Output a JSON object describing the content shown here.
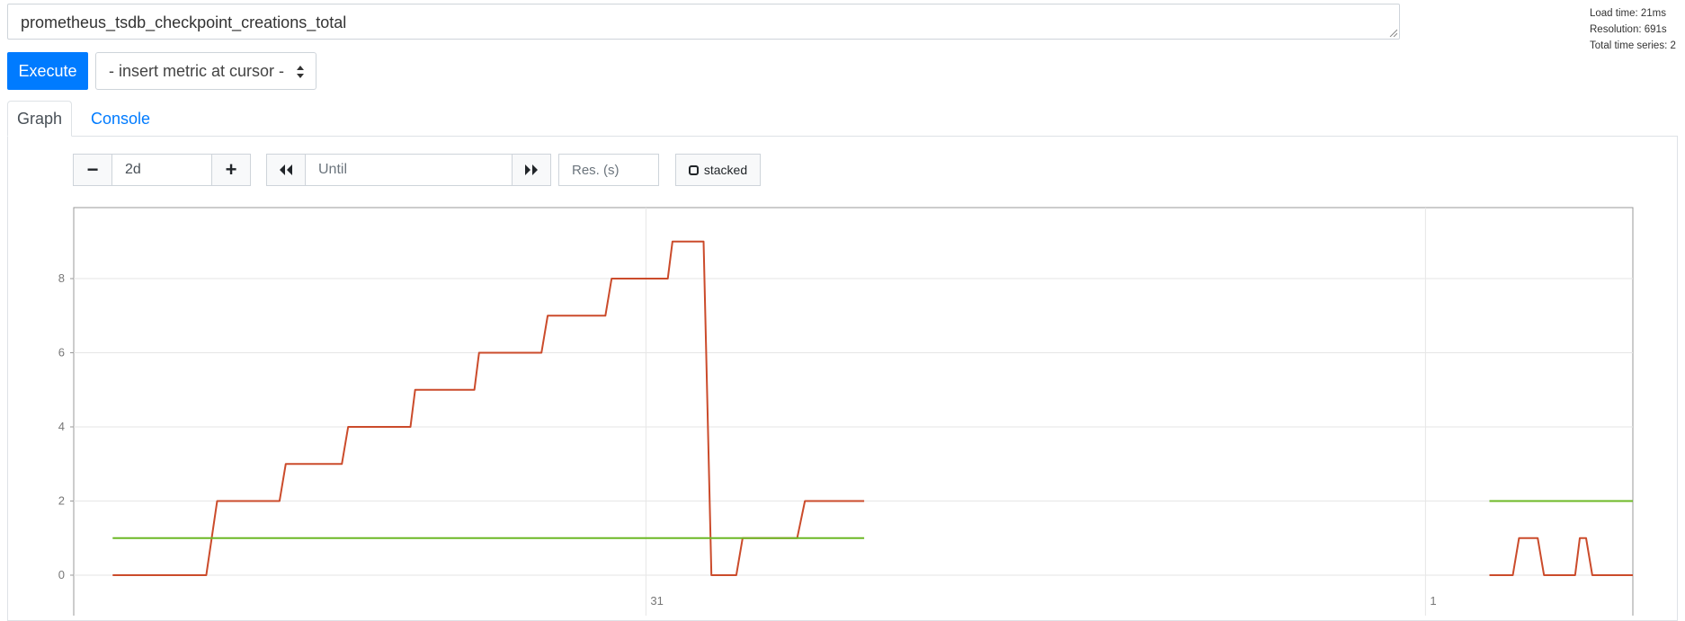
{
  "query": {
    "value": "prometheus_tsdb_checkpoint_creations_total"
  },
  "stats": {
    "load_time": "Load time: 21ms",
    "resolution": "Resolution: 691s",
    "total_series": "Total time series: 2"
  },
  "toolbar": {
    "execute_label": "Execute",
    "metric_select_label": "- insert metric at cursor -"
  },
  "tabs": [
    {
      "label": "Graph",
      "active": true
    },
    {
      "label": "Console",
      "active": false
    }
  ],
  "graph_controls": {
    "range_decrease": "−",
    "range_value": "2d",
    "range_increase": "+",
    "back_icon": "double-chevron-left-icon",
    "until_placeholder": "Until",
    "forward_icon": "double-chevron-right-icon",
    "resolution_placeholder": "Res. (s)",
    "stacked_label": "stacked"
  },
  "chart_data": {
    "type": "line",
    "ylim": [
      0,
      9.6
    ],
    "yticks": [
      0,
      2,
      4,
      6,
      8
    ],
    "xticks": [
      {
        "t": 0.367,
        "label": "31"
      },
      {
        "t": 0.867,
        "label": "1"
      }
    ],
    "grid": true,
    "series": [
      {
        "color": "#cb4b2b",
        "segments": [
          [
            [
              0.025,
              0
            ],
            [
              0.085,
              0
            ],
            [
              0.092,
              2
            ],
            [
              0.132,
              2
            ],
            [
              0.136,
              3
            ],
            [
              0.172,
              3
            ],
            [
              0.176,
              4
            ],
            [
              0.216,
              4
            ],
            [
              0.219,
              5
            ],
            [
              0.257,
              5
            ],
            [
              0.26,
              6
            ],
            [
              0.3,
              6
            ],
            [
              0.304,
              7
            ],
            [
              0.341,
              7
            ],
            [
              0.345,
              8
            ],
            [
              0.381,
              8
            ],
            [
              0.384,
              9
            ],
            [
              0.404,
              9
            ],
            [
              0.409,
              0
            ],
            [
              0.425,
              0
            ],
            [
              0.429,
              1
            ],
            [
              0.464,
              1
            ],
            [
              0.469,
              2
            ],
            [
              0.507,
              2
            ]
          ],
          [
            [
              0.908,
              0
            ],
            [
              0.923,
              0
            ],
            [
              0.927,
              1
            ],
            [
              0.939,
              1
            ],
            [
              0.943,
              0
            ],
            [
              0.963,
              0
            ],
            [
              0.966,
              1
            ],
            [
              0.97,
              1
            ],
            [
              0.974,
              0
            ],
            [
              1.0,
              0
            ]
          ]
        ]
      },
      {
        "color": "#6cb825",
        "segments": [
          [
            [
              0.025,
              1
            ],
            [
              0.507,
              1
            ]
          ],
          [
            [
              0.908,
              2
            ],
            [
              1.0,
              2
            ]
          ]
        ]
      }
    ]
  }
}
